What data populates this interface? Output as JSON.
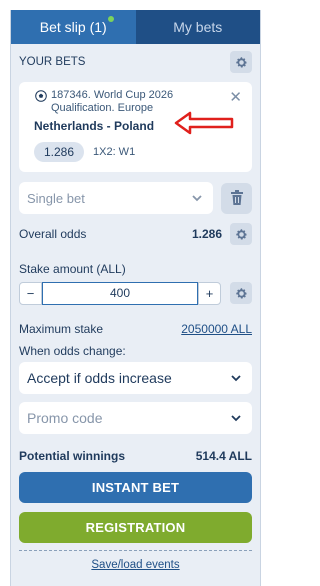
{
  "tabs": [
    {
      "label": "Bet slip (1)",
      "active": true,
      "has_dot": true
    },
    {
      "label": "My bets",
      "active": false
    }
  ],
  "section_title": "YOUR BETS",
  "bet": {
    "event": "187346. World Cup 2026 Qualification. Europe",
    "teams": "Netherlands - Poland",
    "odds": "1.286",
    "market": "1X2: W1"
  },
  "bet_type": "Single bet",
  "overall_odds": {
    "label": "Overall odds",
    "value": "1.286"
  },
  "stake": {
    "label": "Stake amount (ALL)",
    "value": "400",
    "minus": "−",
    "plus": "+"
  },
  "max_stake": {
    "label": "Maximum stake",
    "value": "2050000 ALL"
  },
  "odds_change": {
    "label": "When odds change:",
    "value": "Accept if odds increase"
  },
  "promo": {
    "placeholder": "Promo code"
  },
  "winnings": {
    "label": "Potential winnings",
    "value": "514.4 ALL"
  },
  "buttons": {
    "instant": "INSTANT BET",
    "registration": "REGISTRATION"
  },
  "save_load": "Save/load events",
  "colors": {
    "tab_active": "#2f6fb0",
    "tab_inactive": "#1f4f86",
    "instant_bet": "#2f6fb0",
    "registration": "#7fab2e",
    "annotation_arrow": "#e0201c"
  },
  "icons": [
    "gear-icon",
    "soccer-ball-icon",
    "close-icon",
    "red-arrow-annotation",
    "chevron-down-icon",
    "trash-icon"
  ]
}
